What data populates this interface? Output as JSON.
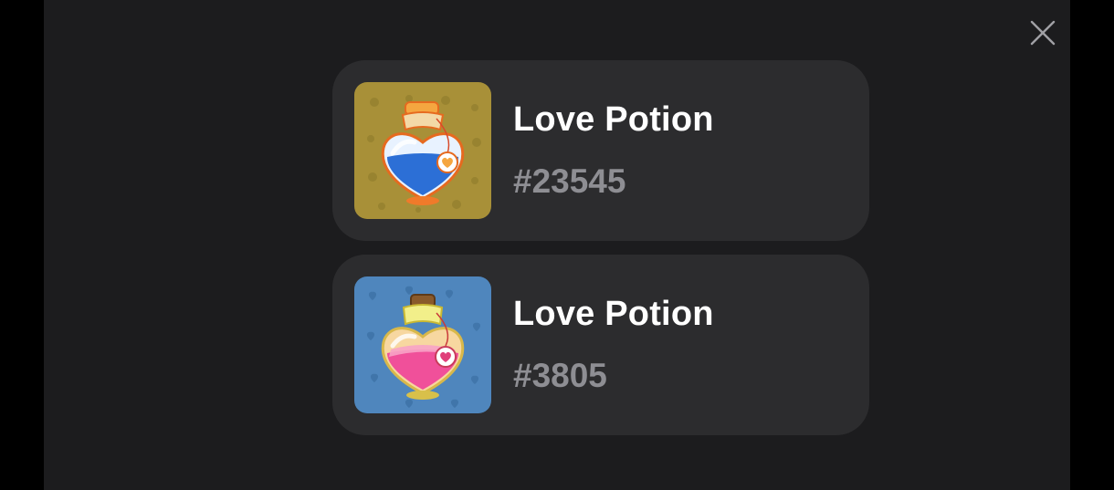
{
  "close": {
    "icon": "close-icon"
  },
  "items": [
    {
      "title": "Love Potion",
      "number": "#23545",
      "icon": "blue-heart-potion-icon",
      "thumb_bg": "#a89038"
    },
    {
      "title": "Love Potion",
      "number": "#3805",
      "icon": "pink-heart-potion-icon",
      "thumb_bg": "#4f86bd"
    }
  ],
  "colors": {
    "backdrop": "#000000",
    "modal": "#1c1c1e",
    "card": "#2c2c2e",
    "title": "#ffffff",
    "number": "#8e8e93"
  }
}
